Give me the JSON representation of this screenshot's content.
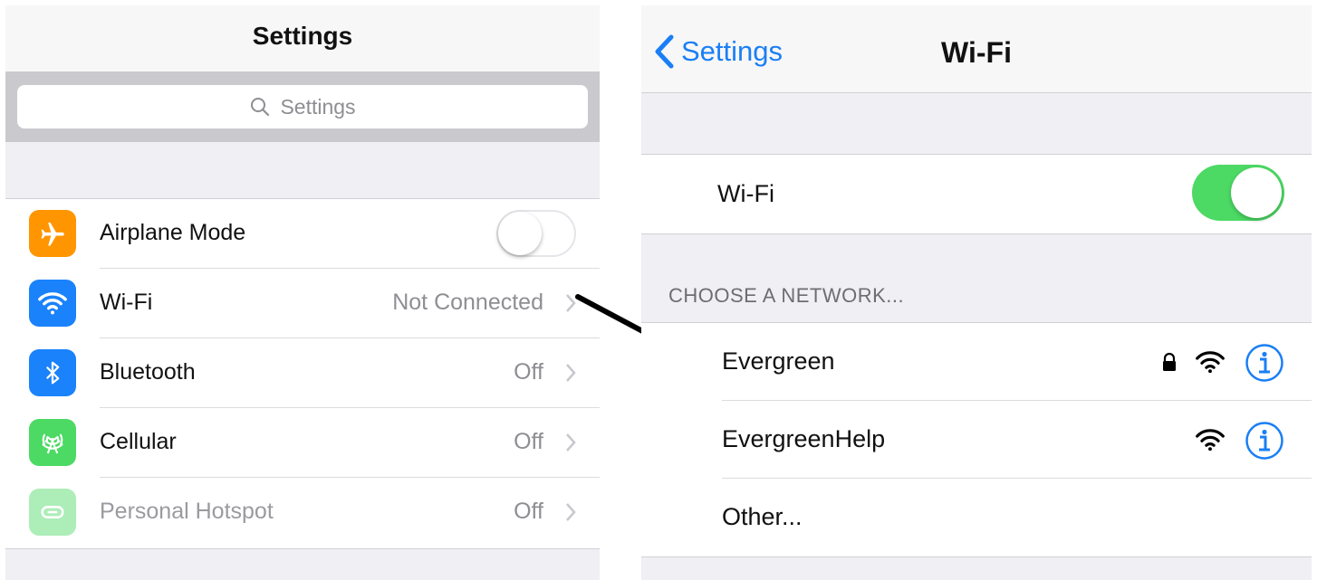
{
  "left": {
    "nav_title": "Settings",
    "search_placeholder": "Settings",
    "rows": [
      {
        "label": "Airplane Mode",
        "icon": "airplane-icon",
        "color": "#ff9500",
        "toggle": false
      },
      {
        "label": "Wi-Fi",
        "value": "Not Connected",
        "icon": "wifi-icon",
        "color": "#1a82fb"
      },
      {
        "label": "Bluetooth",
        "value": "Off",
        "icon": "bluetooth-icon",
        "color": "#1a82fb"
      },
      {
        "label": "Cellular",
        "value": "Off",
        "icon": "cellular-antenna-icon",
        "color": "#4cd964"
      },
      {
        "label": "Personal Hotspot",
        "value": "Off",
        "icon": "hotspot-icon",
        "color": "#4cd964",
        "disabled": true
      }
    ]
  },
  "right": {
    "back_label": "Settings",
    "nav_title": "Wi-Fi",
    "wifi_label": "Wi-Fi",
    "wifi_on": true,
    "section_header": "CHOOSE A NETWORK...",
    "networks": [
      {
        "name": "Evergreen",
        "secured": true
      },
      {
        "name": "EvergreenHelp",
        "secured": false
      },
      {
        "name": "Other...",
        "secured": false
      }
    ]
  },
  "colors": {
    "accent": "#1a7ff5",
    "toggle_on": "#4cd964",
    "orange": "#ff9500"
  }
}
